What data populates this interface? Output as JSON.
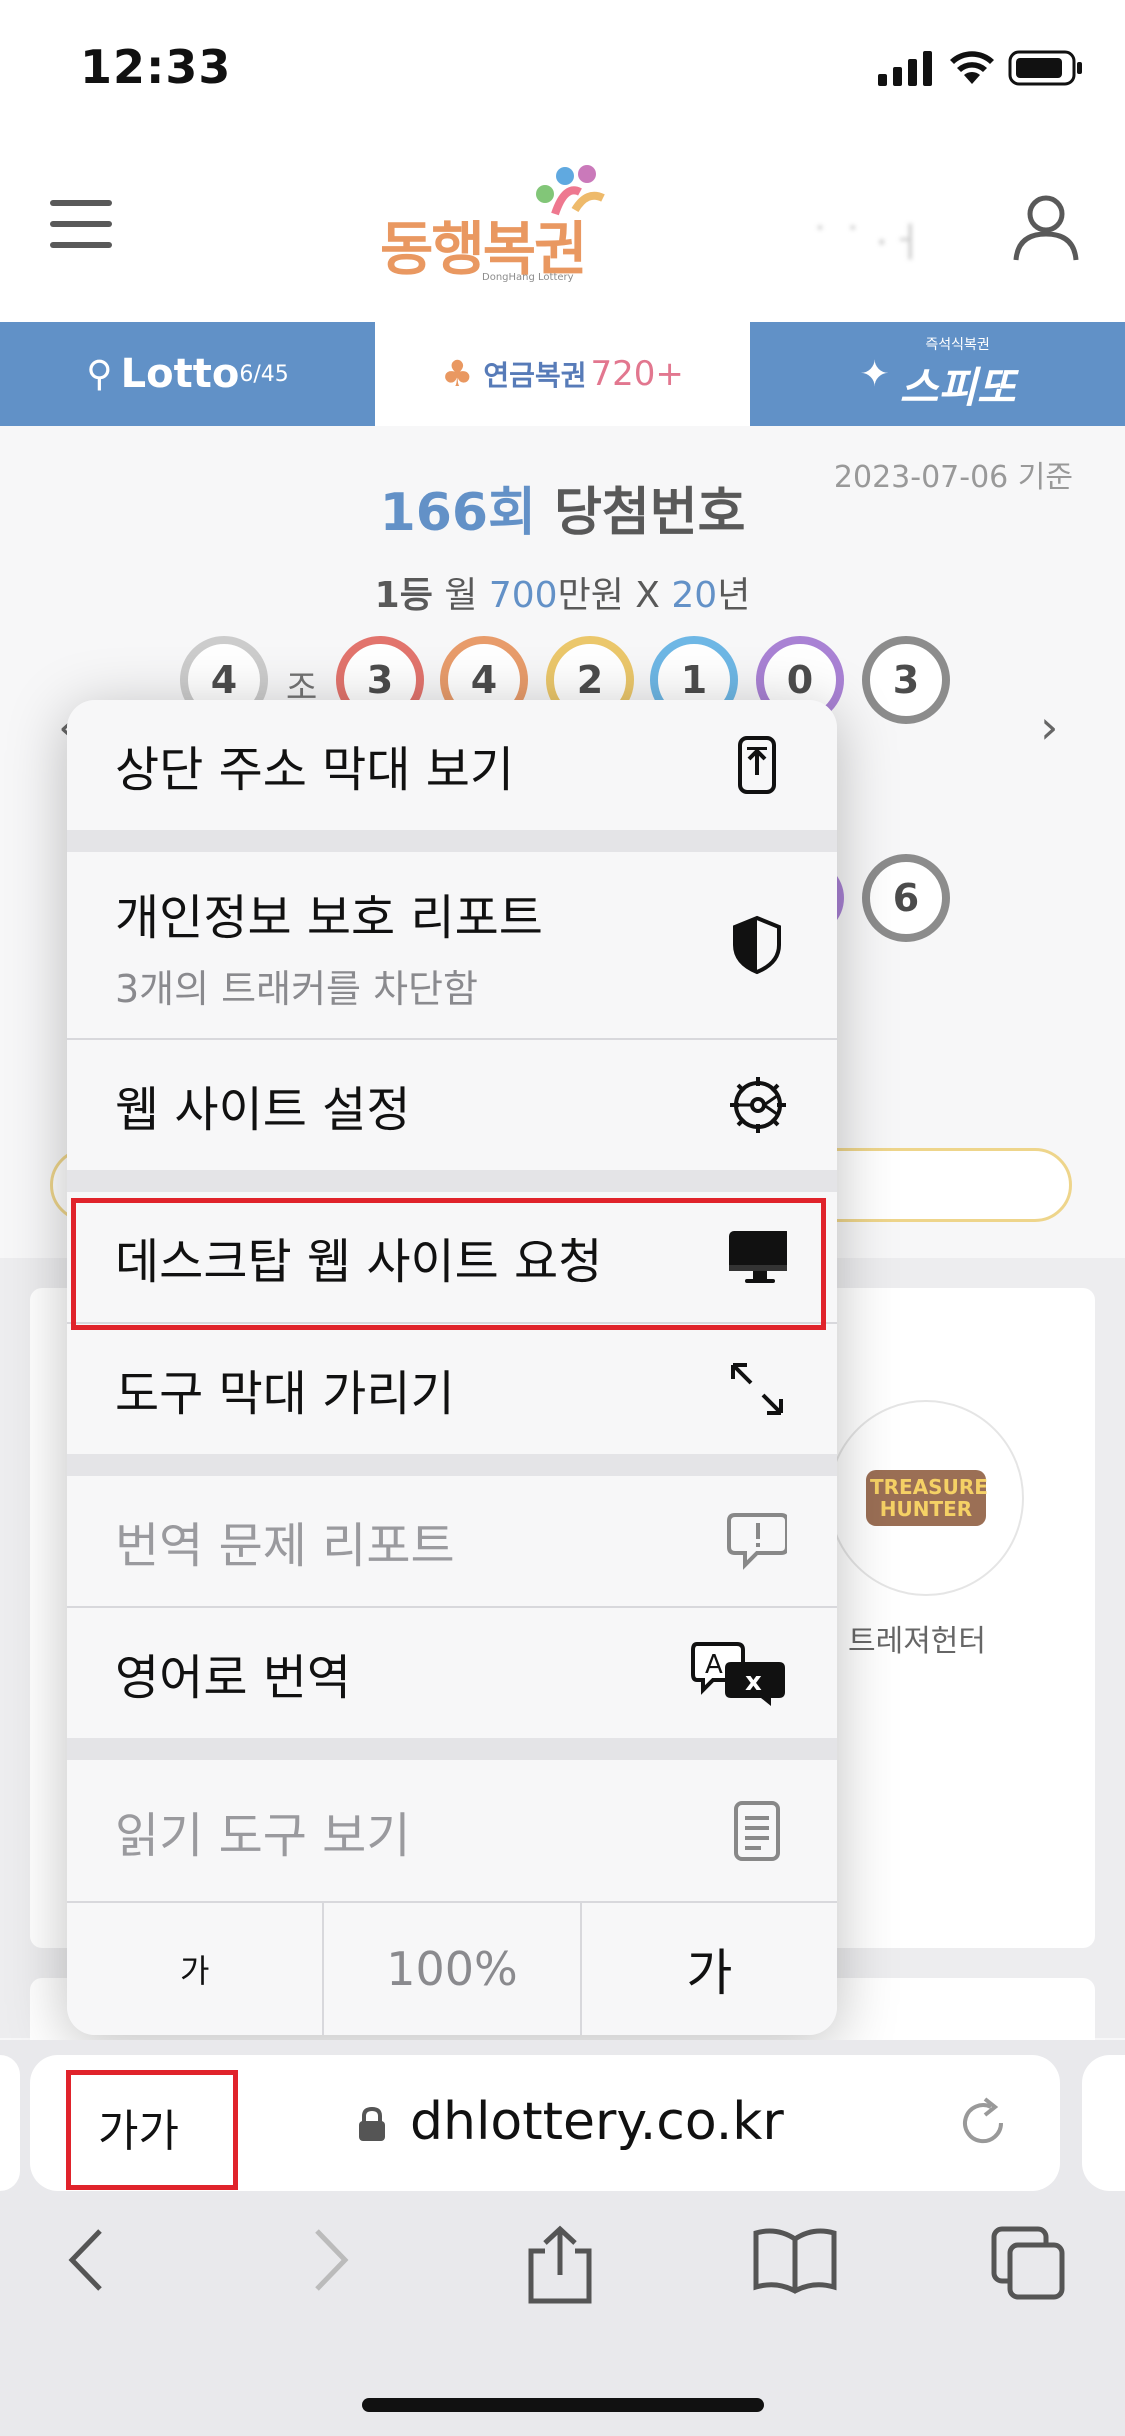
{
  "status_bar": {
    "time": "12:33"
  },
  "header": {
    "logo_text": "동행복권",
    "logo_sub": "DongHang Lottery",
    "blurred_text": "˙ ˙ ·ㅓ"
  },
  "tabs": [
    {
      "label": "Lotto",
      "sub": "6/45"
    },
    {
      "label": "연금복권",
      "sub": "720+"
    },
    {
      "label": "스피또",
      "sub": "즉석식복권"
    }
  ],
  "results": {
    "date": "2023-07-06 기준",
    "round": "166회",
    "title": "당첨번호",
    "prize_rank": "1등",
    "prize_monthly": "월",
    "prize_amount": "700",
    "prize_unit": "만원 X",
    "prize_years": "20",
    "prize_years_unit": "년",
    "group": "4",
    "group_label": "조",
    "numbers": [
      "3",
      "4",
      "2",
      "1",
      "0",
      "3"
    ],
    "ball_colors": [
      "#d9463d",
      "#e07b3a",
      "#e5b43a",
      "#3e9fdc",
      "#8d58c6",
      "#666666"
    ],
    "bonus_last": "6",
    "nav_prev": "‹",
    "nav_next": "›"
  },
  "games": {
    "treasure_hunter_label": "트레져헌터",
    "treasure_logo": "TREASURE HUNTER"
  },
  "menu": {
    "items": [
      {
        "label": "상단 주소 막대 보기",
        "icon": "phone-top-icon"
      },
      {
        "label": "개인정보 보호 리포트",
        "sub": "3개의 트래커를 차단함",
        "icon": "shield-icon"
      },
      {
        "label": "웹 사이트 설정",
        "icon": "gear-icon"
      },
      {
        "label": "데스크탑 웹 사이트 요청",
        "icon": "desktop-icon"
      },
      {
        "label": "도구 막대 가리기",
        "icon": "expand-icon"
      },
      {
        "label": "번역 문제 리포트",
        "icon": "report-bubble-icon"
      },
      {
        "label": "영어로 번역",
        "icon": "translate-icon"
      },
      {
        "label": "읽기 도구 보기",
        "icon": "reader-icon"
      }
    ],
    "font_small": "가",
    "zoom": "100%",
    "font_large": "가"
  },
  "url_bar": {
    "aa_label": "가가",
    "url": "dhlottery.co.kr"
  }
}
